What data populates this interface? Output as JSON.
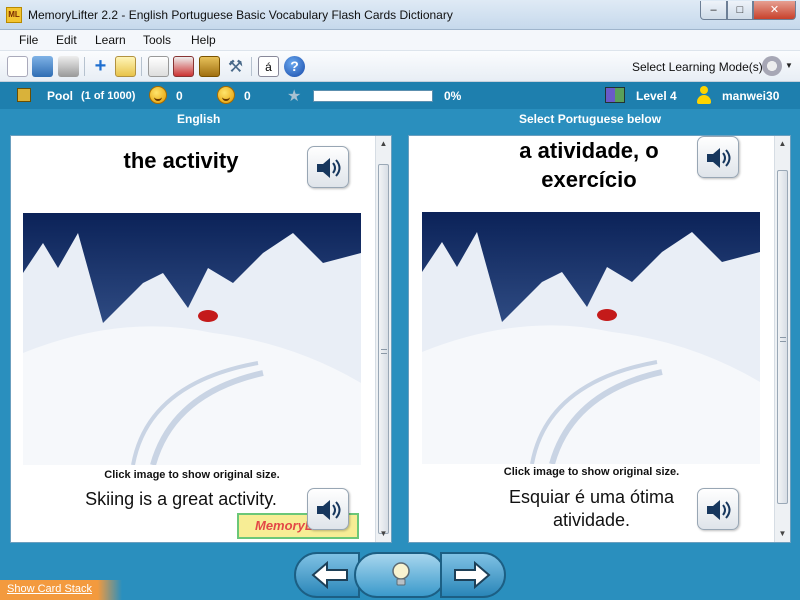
{
  "window": {
    "title": "MemoryLifter 2.2 - English Portuguese Basic Vocabulary Flash Cards Dictionary",
    "app_icon_text": "ML"
  },
  "menu": [
    "File",
    "Edit",
    "Learn",
    "Tools",
    "Help"
  ],
  "toolbar": {
    "icons": [
      "new-icon",
      "open-icon",
      "print-icon",
      "add-card-icon",
      "edit-card-icon",
      "presentation-icon",
      "statistics-icon",
      "print-cards-icon",
      "settings-tools-icon",
      "special-char-icon",
      "help-icon"
    ],
    "special_char_label": "á",
    "help_label": "?",
    "select_mode_label": "Select Learning Mode(s)"
  },
  "status": {
    "pool_label": "Pool",
    "pool_count": "(1 of 1000)",
    "correct_count": "0",
    "wrong_count": "0",
    "progress_percent": 0,
    "progress_text": "0%",
    "level": "Level 4",
    "user": "manwei30"
  },
  "left": {
    "header": "English",
    "word": "the activity",
    "caption": "Click image to show original size.",
    "example": "Skiing is a great activity.",
    "logo_text": "MemoryLifter"
  },
  "right": {
    "header": "Select Portuguese below",
    "word": "a atividade, o exercício",
    "caption": "Click image to show original size.",
    "example": "Esquiar é uma ótima atividade."
  },
  "footer": {
    "show_stack_label": "Show Card Stack"
  },
  "colors": {
    "accent": "#2a8fbe",
    "status_bar": "#1e7fae",
    "progress": "#5fc45f",
    "stack_link": "#f39a3e"
  }
}
